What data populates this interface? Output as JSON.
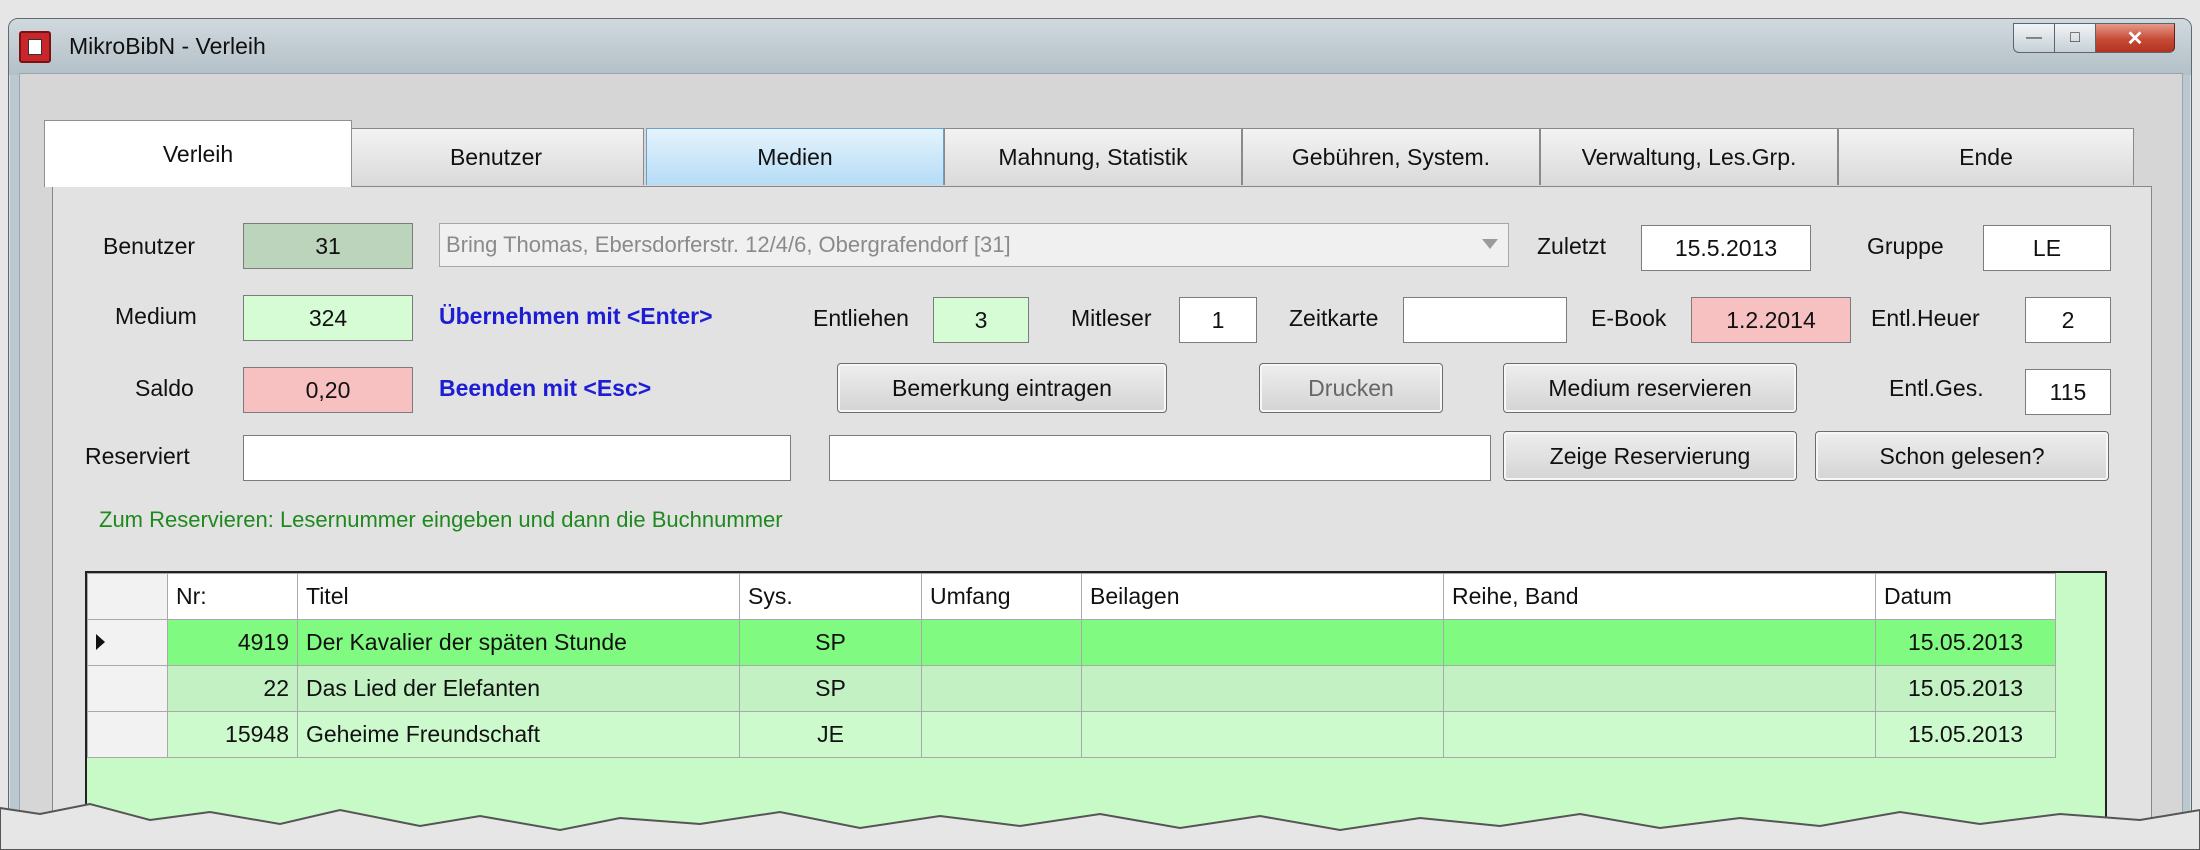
{
  "window": {
    "title": "MikroBibN - Verleih"
  },
  "tabs": [
    {
      "label": "Verleih"
    },
    {
      "label": "Benutzer"
    },
    {
      "label": "Medien"
    },
    {
      "label": "Mahnung, Statistik"
    },
    {
      "label": "Gebühren, System."
    },
    {
      "label": "Verwaltung, Les.Grp."
    },
    {
      "label": "Ende"
    }
  ],
  "form": {
    "benutzer_label": "Benutzer",
    "benutzer_value": "31",
    "benutzer_combo": "Bring Thomas, Ebersdorferstr. 12/4/6, Obergrafendorf  [31]",
    "zuletzt_label": "Zuletzt",
    "zuletzt_value": "15.5.2013",
    "gruppe_label": "Gruppe",
    "gruppe_value": "LE",
    "medium_label": "Medium",
    "medium_value": "324",
    "hint_enter": "Übernehmen mit <Enter>",
    "entliehen_label": "Entliehen",
    "entliehen_value": "3",
    "mitleser_label": "Mitleser",
    "mitleser_value": "1",
    "zeitkarte_label": "Zeitkarte",
    "zeitkarte_value": "",
    "ebook_label": "E-Book",
    "ebook_value": "1.2.2014",
    "entl_heuer_label": "Entl.Heuer",
    "entl_heuer_value": "2",
    "saldo_label": "Saldo",
    "saldo_value": "0,20",
    "hint_esc": "Beenden mit <Esc>",
    "btn_bemerkung": "Bemerkung eintragen",
    "btn_drucken": "Drucken",
    "btn_reservieren": "Medium reservieren",
    "entl_ges_label": "Entl.Ges.",
    "entl_ges_value": "115",
    "reserviert_label": "Reserviert",
    "reserviert_value1": "",
    "reserviert_value2": "",
    "btn_zeige": "Zeige Reservierung",
    "btn_schon": "Schon gelesen?",
    "hint_reservieren": "Zum Reservieren:  Lesernummer eingeben und dann die Buchnummer"
  },
  "grid": {
    "columns": [
      "Nr:",
      "Titel",
      "Sys.",
      "Umfang",
      "Beilagen",
      "Reihe, Band",
      "Datum"
    ],
    "rows": [
      {
        "nr": "4919",
        "titel": "Der Kavalier der späten Stunde",
        "sys": "SP",
        "umfang": "",
        "beilagen": "",
        "reihe": "",
        "datum": "15.05.2013"
      },
      {
        "nr": "22",
        "titel": "Das Lied der Elefanten",
        "sys": "SP",
        "umfang": "",
        "beilagen": "",
        "reihe": "",
        "datum": "15.05.2013"
      },
      {
        "nr": "15948",
        "titel": "Geheime Freundschaft",
        "sys": "JE",
        "umfang": "",
        "beilagen": "",
        "reihe": "",
        "datum": "15.05.2013"
      }
    ]
  },
  "colors": {
    "benutzer_field": "#bcd3bc",
    "medium_field": "#d6fcd6",
    "saldo_field": "#f7c1c1",
    "ebook_field": "#f7c1c1",
    "selected_row": "#80fa80",
    "grid_bg": "#c8fac8",
    "hint_blue": "#1d1dd4",
    "hint_green": "#1e8a1e"
  }
}
